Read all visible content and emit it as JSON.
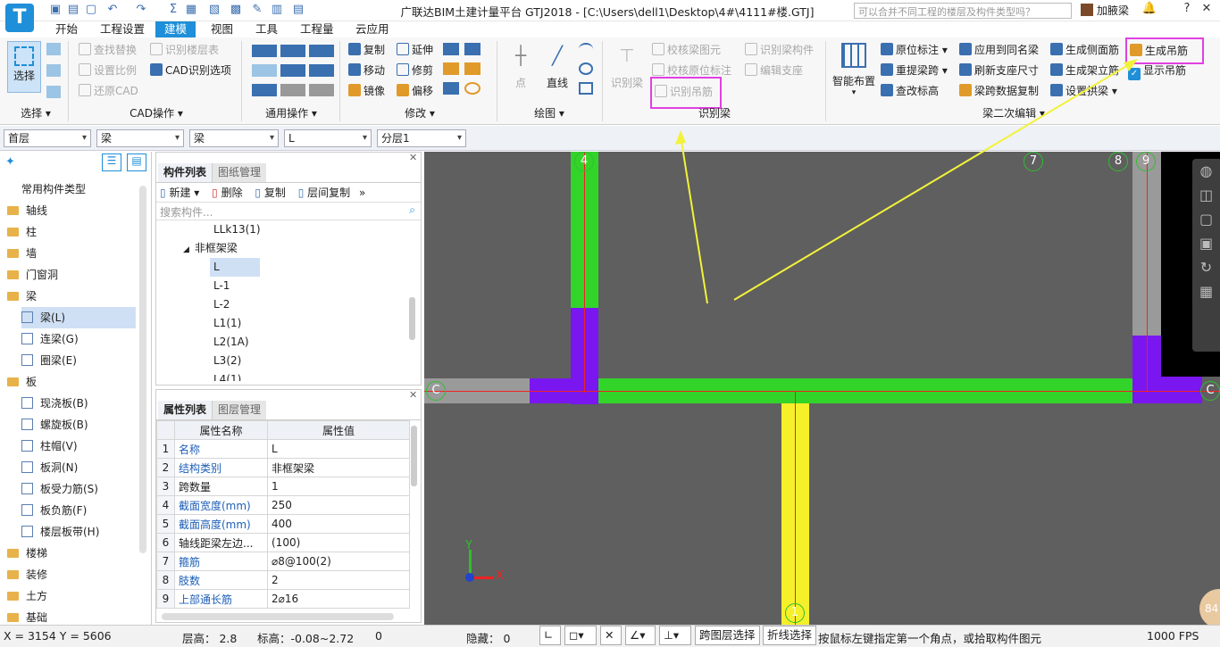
{
  "app": {
    "title": "广联达BIM土建计量平台 GTJ2018 - [C:\\Users\\dell1\\Desktop\\4#\\4111#楼.GTJ]",
    "logo_letter": "T",
    "search_placeholder": "可以合并不同工程的楼层及构件类型吗？",
    "user_name": "加腋梁",
    "window_buttons": {
      "help": "?",
      "minimize": "–",
      "restore": "❐",
      "close": "✕"
    }
  },
  "menu_tabs": [
    {
      "label": "开始"
    },
    {
      "label": "工程设置"
    },
    {
      "label": "建模"
    },
    {
      "label": "视图"
    },
    {
      "label": "工具"
    },
    {
      "label": "工程量"
    },
    {
      "label": "云应用"
    }
  ],
  "ribbon": {
    "select": {
      "label": "选择",
      "group": "选择"
    },
    "cad": {
      "items": [
        "查找替换",
        "识别楼层表",
        "设置比例",
        "CAD识别选项",
        "还原CAD"
      ],
      "group": "CAD操作"
    },
    "common": {
      "group": "通用操作"
    },
    "modify": {
      "items": [
        "复制",
        "延伸",
        "移动",
        "修剪",
        "镜像",
        "偏移"
      ],
      "group": "修改"
    },
    "draw": {
      "point": "点",
      "line": "直线",
      "group": "绘图"
    },
    "recognize": {
      "beam": "识别梁",
      "check_beam": "校核梁图元",
      "check_origin": "校核原位标注",
      "recognize_hanger": "识别吊筋",
      "recognize_beam_member": "识别梁构件",
      "edit_support": "编辑支座",
      "group": "识别梁"
    },
    "beam_edit": {
      "smart_layout": "智能布置",
      "origin_label": "原位标注",
      "lift_span": "重提梁跨",
      "check_elev": "查改标高",
      "apply_same": "应用到同名梁",
      "refresh_support": "刷新支座尺寸",
      "span_copy": "梁跨数据复制",
      "gen_side": "生成侧面筋",
      "gen_stand": "生成架立筋",
      "set_arch": "设置拱梁",
      "gen_hanger": "生成吊筋",
      "show_hanger": "显示吊筋",
      "group": "梁二次编辑"
    }
  },
  "selectors": {
    "floor": "首层",
    "category": "梁",
    "type": "梁",
    "member": "L",
    "layer": "分层1"
  },
  "tree": {
    "common": "常用构件类型",
    "items": [
      {
        "label": "轴线",
        "kind": "folder"
      },
      {
        "label": "柱",
        "kind": "folder"
      },
      {
        "label": "墙",
        "kind": "folder"
      },
      {
        "label": "门窗洞",
        "kind": "folder"
      },
      {
        "label": "梁",
        "kind": "folder"
      },
      {
        "label": "梁(L)",
        "kind": "leaf",
        "selected": true
      },
      {
        "label": "连梁(G)",
        "kind": "leaf"
      },
      {
        "label": "圈梁(E)",
        "kind": "leaf"
      },
      {
        "label": "板",
        "kind": "folder"
      },
      {
        "label": "现浇板(B)",
        "kind": "leaf"
      },
      {
        "label": "螺旋板(B)",
        "kind": "leaf"
      },
      {
        "label": "柱帽(V)",
        "kind": "leaf"
      },
      {
        "label": "板洞(N)",
        "kind": "leaf"
      },
      {
        "label": "板受力筋(S)",
        "kind": "leaf"
      },
      {
        "label": "板负筋(F)",
        "kind": "leaf"
      },
      {
        "label": "楼层板带(H)",
        "kind": "leaf"
      },
      {
        "label": "楼梯",
        "kind": "folder"
      },
      {
        "label": "装修",
        "kind": "folder"
      },
      {
        "label": "土方",
        "kind": "folder"
      },
      {
        "label": "基础",
        "kind": "folder"
      }
    ]
  },
  "component_panel": {
    "tabs": [
      "构件列表",
      "图纸管理"
    ],
    "toolbar": [
      "新建",
      "删除",
      "复制",
      "层间复制"
    ],
    "search_placeholder": "搜索构件...",
    "items": [
      "LLk13(1)",
      "非框架梁",
      "L",
      "L-1",
      "L-2",
      "L1(1)",
      "L2(1A)",
      "L3(2)",
      "L4(1)"
    ]
  },
  "attr_panel": {
    "tabs": [
      "属性列表",
      "图层管理"
    ],
    "headers": [
      "属性名称",
      "属性值"
    ],
    "rows": [
      {
        "no": "1",
        "name": "名称",
        "value": "L",
        "blue": true
      },
      {
        "no": "2",
        "name": "结构类别",
        "value": "非框架梁",
        "blue": true
      },
      {
        "no": "3",
        "name": "跨数量",
        "value": "1",
        "blue": false
      },
      {
        "no": "4",
        "name": "截面宽度(mm)",
        "value": "250",
        "blue": true
      },
      {
        "no": "5",
        "name": "截面高度(mm)",
        "value": "400",
        "blue": true
      },
      {
        "no": "6",
        "name": "轴线距梁左边...",
        "value": "(100)",
        "blue": false
      },
      {
        "no": "7",
        "name": "箍筋",
        "value": "⌀8@100(2)",
        "blue": true
      },
      {
        "no": "8",
        "name": "肢数",
        "value": "2",
        "blue": true
      },
      {
        "no": "9",
        "name": "上部通长筋",
        "value": "2⌀16",
        "blue": true
      }
    ]
  },
  "canvas": {
    "axes": [
      "4",
      "7",
      "8",
      "9",
      "C",
      "C",
      "1"
    ],
    "ucs": {
      "x": "X",
      "y": "Y"
    },
    "badge": "84"
  },
  "status": {
    "coords": "X = 3154 Y = 5606",
    "floor_height": "层高： 2.8",
    "elevation": "标高：-0.08~2.72",
    "zero": "0",
    "hidden": "隐藏： 0",
    "cross_layer": "跨图层选择",
    "polyline": "折线选择",
    "hint": "按鼠标左键指定第一个角点，或拾取构件图元",
    "fps": "1000 FPS"
  },
  "colors": {
    "accent": "#1e8fd8",
    "beam_green": "#33d42a",
    "beam_purple": "#7a16f0",
    "beam_yellow": "#f5f02a",
    "highlight": "#e040e0",
    "arrow": "#f2f23a",
    "canvas": "#5f5f5f"
  }
}
